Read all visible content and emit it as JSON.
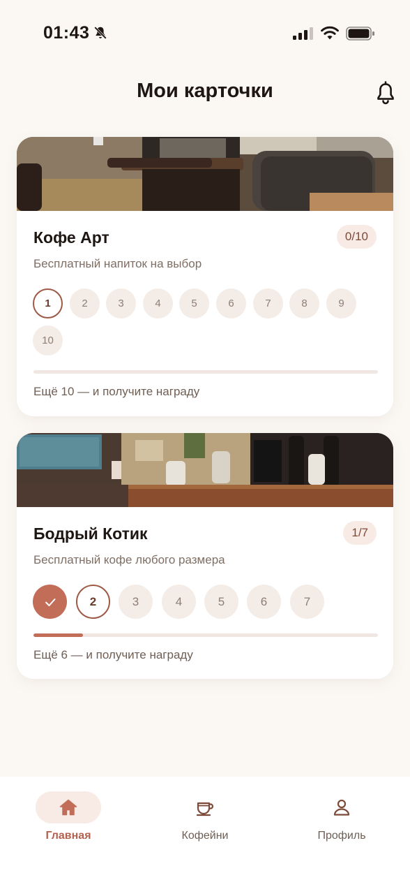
{
  "status_bar": {
    "time": "01:43"
  },
  "header": {
    "title": "Мои карточки"
  },
  "cards": [
    {
      "name": "Кофе Арт",
      "badge": "0/10",
      "subtitle": "Бесплатный напиток на выбор",
      "stamps": [
        "1",
        "2",
        "3",
        "4",
        "5",
        "6",
        "7",
        "8",
        "9",
        "10"
      ],
      "collected": 0,
      "progress": 0,
      "progress_text": "Ещё 10 — и получите награду"
    },
    {
      "name": "Бодрый Котик",
      "badge": "1/7",
      "subtitle": "Бесплатный кофе любого размера",
      "stamps": [
        "✓",
        "2",
        "3",
        "4",
        "5",
        "6",
        "7"
      ],
      "collected": 1,
      "progress": 0.1428,
      "progress_text": "Ещё 6 — и получите награду"
    }
  ],
  "nav": {
    "items": [
      {
        "label": "Главная",
        "icon": "home-icon",
        "active": true
      },
      {
        "label": "Кофейни",
        "icon": "coffee-cup-icon",
        "active": false
      },
      {
        "label": "Профиль",
        "icon": "profile-icon",
        "active": false
      }
    ]
  },
  "colors": {
    "background": "#FBF8F4",
    "accent": "#C16D58",
    "accent_text": "#B4614D",
    "badge_bg": "#F8EAE4",
    "stamp_bg": "#F4ECE7"
  }
}
